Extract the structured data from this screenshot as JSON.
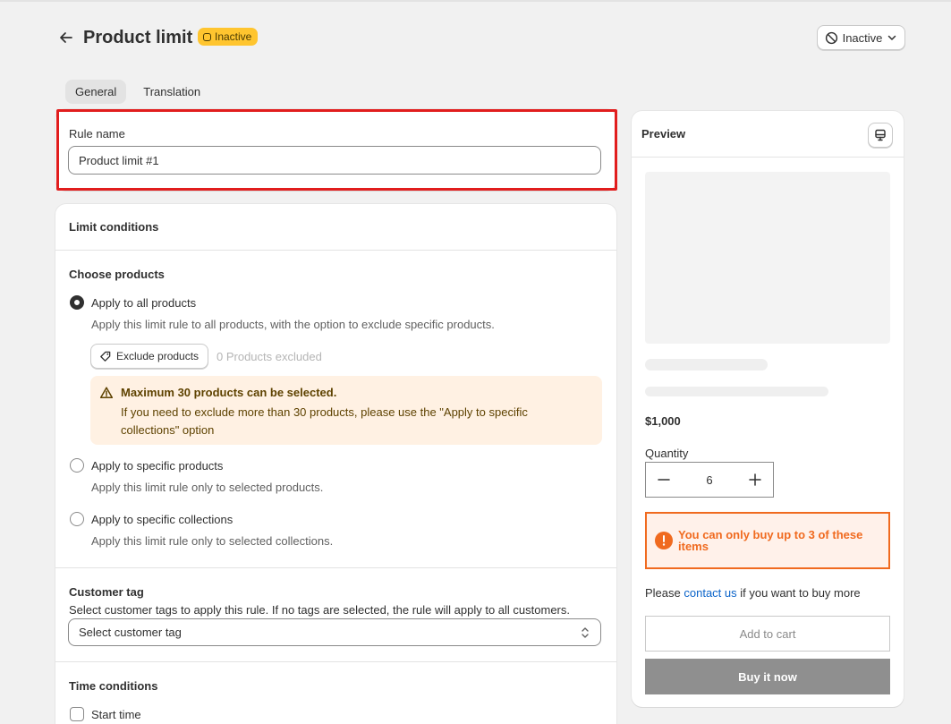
{
  "header": {
    "title": "Product limit",
    "badge": "Inactive",
    "status_button": "Inactive"
  },
  "tabs": [
    {
      "label": "General",
      "active": true
    },
    {
      "label": "Translation",
      "active": false
    }
  ],
  "rule_name": {
    "label": "Rule name",
    "value": "Product limit #1"
  },
  "limit_conditions": {
    "title": "Limit conditions",
    "choose_products": "Choose products",
    "options": [
      {
        "label": "Apply to all products",
        "desc": "Apply this limit rule to all products, with the option to exclude specific products.",
        "checked": true
      },
      {
        "label": "Apply to specific products",
        "desc": "Apply this limit rule only to selected products.",
        "checked": false
      },
      {
        "label": "Apply to specific collections",
        "desc": "Apply this limit rule only to selected collections.",
        "checked": false
      }
    ],
    "exclude_button": "Exclude products",
    "excluded_count": "0 Products excluded",
    "warning_title": "Maximum 30 products can be selected.",
    "warning_text": "If you need to exclude more than 30 products, please use the \"Apply to specific collections\" option"
  },
  "customer_tag": {
    "title": "Customer tag",
    "desc": "Select customer tags to apply this rule. If no tags are selected, the rule will apply to all customers.",
    "placeholder": "Select customer tag"
  },
  "time_conditions": {
    "title": "Time conditions",
    "start_time": "Start time"
  },
  "preview": {
    "title": "Preview",
    "price": "$1,000",
    "quantity_label": "Quantity",
    "quantity": "6",
    "limit_message": "You can only buy up to 3 of these items",
    "contact_prefix": "Please ",
    "contact_link": "contact us",
    "contact_suffix": " if you want to buy more",
    "add_to_cart": "Add to cart",
    "buy_now": "Buy it now"
  },
  "colors": {
    "badge": "#ffc52f",
    "highlight": "#e11d1d",
    "limit_accent": "#f06a1f",
    "link": "#0a63c9"
  }
}
